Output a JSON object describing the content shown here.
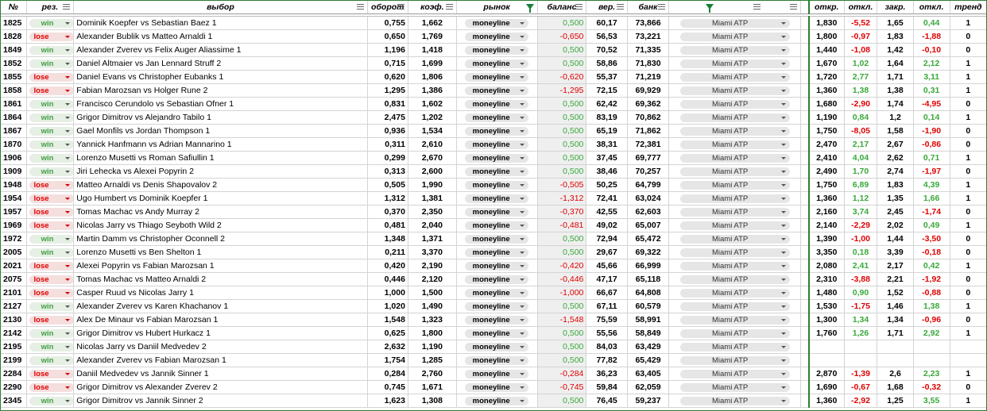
{
  "headers": {
    "num": "№",
    "res": "рез.",
    "pick": "выбор",
    "turnover": "оборот",
    "coef": "коэф.",
    "market": "рынок",
    "balance": "баланс",
    "prob": "вер.",
    "bank": "банк",
    "open": "откр.",
    "dev1": "откл.",
    "close": "закр.",
    "dev2": "откл.",
    "trend": "тренд"
  },
  "rows": [
    {
      "id": "1825",
      "res": "win",
      "pick": "Dominik Koepfer  vs  Sebastian Baez 1",
      "turnover": "0,755",
      "coef": "1,662",
      "market": "moneyline",
      "balance": "0,500",
      "prob": "60,17",
      "bank": "73,866",
      "tournament": "Miami ATP",
      "open": "1,830",
      "dev1": "-5,52",
      "close": "1,65",
      "dev2": "0,44",
      "trend": "1"
    },
    {
      "id": "1828",
      "res": "lose",
      "pick": "Alexander Bublik  vs  Matteo Arnaldi 1",
      "turnover": "0,650",
      "coef": "1,769",
      "market": "moneyline",
      "balance": "-0,650",
      "prob": "56,53",
      "bank": "73,221",
      "tournament": "Miami ATP",
      "open": "1,800",
      "dev1": "-0,97",
      "close": "1,83",
      "dev2": "-1,88",
      "trend": "0"
    },
    {
      "id": "1849",
      "res": "win",
      "pick": "Alexander Zverev  vs  Felix Auger Aliassime 1",
      "turnover": "1,196",
      "coef": "1,418",
      "market": "moneyline",
      "balance": "0,500",
      "prob": "70,52",
      "bank": "71,335",
      "tournament": "Miami ATP",
      "open": "1,440",
      "dev1": "-1,08",
      "close": "1,42",
      "dev2": "-0,10",
      "trend": "0"
    },
    {
      "id": "1852",
      "res": "win",
      "pick": "Daniel Altmaier  vs  Jan Lennard Struff 2",
      "turnover": "0,715",
      "coef": "1,699",
      "market": "moneyline",
      "balance": "0,500",
      "prob": "58,86",
      "bank": "71,830",
      "tournament": "Miami ATP",
      "open": "1,670",
      "dev1": "1,02",
      "close": "1,64",
      "dev2": "2,12",
      "trend": "1"
    },
    {
      "id": "1855",
      "res": "lose",
      "pick": "Daniel Evans  vs  Christopher Eubanks 1",
      "turnover": "0,620",
      "coef": "1,806",
      "market": "moneyline",
      "balance": "-0,620",
      "prob": "55,37",
      "bank": "71,219",
      "tournament": "Miami ATP",
      "open": "1,720",
      "dev1": "2,77",
      "close": "1,71",
      "dev2": "3,11",
      "trend": "1"
    },
    {
      "id": "1858",
      "res": "lose",
      "pick": "Fabian Marozsan  vs  Holger Rune 2",
      "turnover": "1,295",
      "coef": "1,386",
      "market": "moneyline",
      "balance": "-1,295",
      "prob": "72,15",
      "bank": "69,929",
      "tournament": "Miami ATP",
      "open": "1,360",
      "dev1": "1,38",
      "close": "1,38",
      "dev2": "0,31",
      "trend": "1"
    },
    {
      "id": "1861",
      "res": "win",
      "pick": "Francisco Cerundolo  vs  Sebastian Ofner 1",
      "turnover": "0,831",
      "coef": "1,602",
      "market": "moneyline",
      "balance": "0,500",
      "prob": "62,42",
      "bank": "69,362",
      "tournament": "Miami ATP",
      "open": "1,680",
      "dev1": "-2,90",
      "close": "1,74",
      "dev2": "-4,95",
      "trend": "0"
    },
    {
      "id": "1864",
      "res": "win",
      "pick": "Grigor Dimitrov  vs  Alejandro Tabilo 1",
      "turnover": "2,475",
      "coef": "1,202",
      "market": "moneyline",
      "balance": "0,500",
      "prob": "83,19",
      "bank": "70,862",
      "tournament": "Miami ATP",
      "open": "1,190",
      "dev1": "0,84",
      "close": "1,2",
      "dev2": "0,14",
      "trend": "1"
    },
    {
      "id": "1867",
      "res": "win",
      "pick": "Gael Monfils  vs  Jordan Thompson 1",
      "turnover": "0,936",
      "coef": "1,534",
      "market": "moneyline",
      "balance": "0,500",
      "prob": "65,19",
      "bank": "71,862",
      "tournament": "Miami ATP",
      "open": "1,750",
      "dev1": "-8,05",
      "close": "1,58",
      "dev2": "-1,90",
      "trend": "0"
    },
    {
      "id": "1870",
      "res": "win",
      "pick": "Yannick Hanfmann  vs  Adrian Mannarino 1",
      "turnover": "0,311",
      "coef": "2,610",
      "market": "moneyline",
      "balance": "0,500",
      "prob": "38,31",
      "bank": "72,381",
      "tournament": "Miami ATP",
      "open": "2,470",
      "dev1": "2,17",
      "close": "2,67",
      "dev2": "-0,86",
      "trend": "0"
    },
    {
      "id": "1906",
      "res": "win",
      "pick": "Lorenzo Musetti  vs  Roman Safiullin 1",
      "turnover": "0,299",
      "coef": "2,670",
      "market": "moneyline",
      "balance": "0,500",
      "prob": "37,45",
      "bank": "69,777",
      "tournament": "Miami ATP",
      "open": "2,410",
      "dev1": "4,04",
      "close": "2,62",
      "dev2": "0,71",
      "trend": "1"
    },
    {
      "id": "1909",
      "res": "win",
      "pick": "Jiri Lehecka  vs  Alexei Popyrin 2",
      "turnover": "0,313",
      "coef": "2,600",
      "market": "moneyline",
      "balance": "0,500",
      "prob": "38,46",
      "bank": "70,257",
      "tournament": "Miami ATP",
      "open": "2,490",
      "dev1": "1,70",
      "close": "2,74",
      "dev2": "-1,97",
      "trend": "0"
    },
    {
      "id": "1948",
      "res": "lose",
      "pick": "Matteo Arnaldi  vs  Denis Shapovalov 2",
      "turnover": "0,505",
      "coef": "1,990",
      "market": "moneyline",
      "balance": "-0,505",
      "prob": "50,25",
      "bank": "64,799",
      "tournament": "Miami ATP",
      "open": "1,750",
      "dev1": "6,89",
      "close": "1,83",
      "dev2": "4,39",
      "trend": "1"
    },
    {
      "id": "1954",
      "res": "lose",
      "pick": "Ugo Humbert  vs  Dominik Koepfer 1",
      "turnover": "1,312",
      "coef": "1,381",
      "market": "moneyline",
      "balance": "-1,312",
      "prob": "72,41",
      "bank": "63,024",
      "tournament": "Miami ATP",
      "open": "1,360",
      "dev1": "1,12",
      "close": "1,35",
      "dev2": "1,66",
      "trend": "1"
    },
    {
      "id": "1957",
      "res": "lose",
      "pick": "Tomas Machac  vs  Andy Murray 2",
      "turnover": "0,370",
      "coef": "2,350",
      "market": "moneyline",
      "balance": "-0,370",
      "prob": "42,55",
      "bank": "62,603",
      "tournament": "Miami ATP",
      "open": "2,160",
      "dev1": "3,74",
      "close": "2,45",
      "dev2": "-1,74",
      "trend": "0"
    },
    {
      "id": "1969",
      "res": "lose",
      "pick": "Nicolas Jarry  vs  Thiago Seyboth Wild 2",
      "turnover": "0,481",
      "coef": "2,040",
      "market": "moneyline",
      "balance": "-0,481",
      "prob": "49,02",
      "bank": "65,007",
      "tournament": "Miami ATP",
      "open": "2,140",
      "dev1": "-2,29",
      "close": "2,02",
      "dev2": "0,49",
      "trend": "1"
    },
    {
      "id": "1972",
      "res": "win",
      "pick": "Martin Damm  vs  Christopher Oconnell 2",
      "turnover": "1,348",
      "coef": "1,371",
      "market": "moneyline",
      "balance": "0,500",
      "prob": "72,94",
      "bank": "65,472",
      "tournament": "Miami ATP",
      "open": "1,390",
      "dev1": "-1,00",
      "close": "1,44",
      "dev2": "-3,50",
      "trend": "0"
    },
    {
      "id": "2005",
      "res": "win",
      "pick": "Lorenzo Musetti  vs  Ben Shelton 1",
      "turnover": "0,211",
      "coef": "3,370",
      "market": "moneyline",
      "balance": "0,500",
      "prob": "29,67",
      "bank": "69,322",
      "tournament": "Miami ATP",
      "open": "3,350",
      "dev1": "0,18",
      "close": "3,39",
      "dev2": "-0,18",
      "trend": "0"
    },
    {
      "id": "2021",
      "res": "lose",
      "pick": " Alexei Popyrin  vs  Fabian Marozsan 1",
      "turnover": "0,420",
      "coef": "2,190",
      "market": "moneyline",
      "balance": "-0,420",
      "prob": "45,66",
      "bank": "66,999",
      "tournament": "Miami ATP",
      "open": "2,080",
      "dev1": "2,41",
      "close": "2,17",
      "dev2": "0,42",
      "trend": "1"
    },
    {
      "id": "2075",
      "res": "lose",
      "pick": "Tomas Machac  vs  Matteo Arnaldi 2",
      "turnover": "0,446",
      "coef": "2,120",
      "market": "moneyline",
      "balance": "-0,446",
      "prob": "47,17",
      "bank": "65,118",
      "tournament": "Miami ATP",
      "open": "2,310",
      "dev1": "-3,88",
      "close": "2,21",
      "dev2": "-1,92",
      "trend": "0"
    },
    {
      "id": "2101",
      "res": "lose",
      "pick": "Casper Ruud  vs  Nicolas Jarry 1",
      "turnover": "1,000",
      "coef": "1,500",
      "market": "moneyline",
      "balance": "-1,000",
      "prob": "66,67",
      "bank": "64,808",
      "tournament": "Miami ATP",
      "open": "1,480",
      "dev1": "0,90",
      "close": "1,52",
      "dev2": "-0,88",
      "trend": "0"
    },
    {
      "id": "2127",
      "res": "win",
      "pick": "Alexander Zverev  vs  Karen Khachanov 1",
      "turnover": "1,020",
      "coef": "1,490",
      "market": "moneyline",
      "balance": "0,500",
      "prob": "67,11",
      "bank": "60,579",
      "tournament": "Miami ATP",
      "open": "1,530",
      "dev1": "-1,75",
      "close": "1,46",
      "dev2": "1,38",
      "trend": "1"
    },
    {
      "id": "2130",
      "res": "lose",
      "pick": "Alex De Minaur  vs  Fabian Marozsan 1",
      "turnover": "1,548",
      "coef": "1,323",
      "market": "moneyline",
      "balance": "-1,548",
      "prob": "75,59",
      "bank": "58,991",
      "tournament": "Miami ATP",
      "open": "1,300",
      "dev1": "1,34",
      "close": "1,34",
      "dev2": "-0,96",
      "trend": "0"
    },
    {
      "id": "2142",
      "res": "win",
      "pick": "Grigor Dimitrov  vs  Hubert Hurkacz 1",
      "turnover": "0,625",
      "coef": "1,800",
      "market": "moneyline",
      "balance": "0,500",
      "prob": "55,56",
      "bank": "58,849",
      "tournament": "Miami ATP",
      "open": "1,760",
      "dev1": "1,26",
      "close": "1,71",
      "dev2": "2,92",
      "trend": "1"
    },
    {
      "id": "2195",
      "res": "win",
      "pick": "Nicolas Jarry  vs  Daniil Medvedev 2",
      "turnover": "2,632",
      "coef": "1,190",
      "market": "moneyline",
      "balance": "0,500",
      "prob": "84,03",
      "bank": "63,429",
      "tournament": "Miami ATP",
      "open": "",
      "dev1": "",
      "close": "",
      "dev2": "",
      "trend": ""
    },
    {
      "id": "2199",
      "res": "win",
      "pick": "Alexander Zverev  vs  Fabian Marozsan 1",
      "turnover": "1,754",
      "coef": "1,285",
      "market": "moneyline",
      "balance": "0,500",
      "prob": "77,82",
      "bank": "65,429",
      "tournament": "Miami ATP",
      "open": "",
      "dev1": "",
      "close": "",
      "dev2": "",
      "trend": ""
    },
    {
      "id": "2284",
      "res": "lose",
      "pick": "Daniil Medvedev  vs  Jannik Sinner 1",
      "turnover": "0,284",
      "coef": "2,760",
      "market": "moneyline",
      "balance": "-0,284",
      "prob": "36,23",
      "bank": "63,405",
      "tournament": "Miami ATP",
      "open": "2,870",
      "dev1": "-1,39",
      "close": "2,6",
      "dev2": "2,23",
      "trend": "1"
    },
    {
      "id": "2290",
      "res": "lose",
      "pick": "Grigor Dimitrov  vs  Alexander Zverev 2",
      "turnover": "0,745",
      "coef": "1,671",
      "market": "moneyline",
      "balance": "-0,745",
      "prob": "59,84",
      "bank": "62,059",
      "tournament": "Miami ATP",
      "open": "1,690",
      "dev1": "-0,67",
      "close": "1,68",
      "dev2": "-0,32",
      "trend": "0"
    },
    {
      "id": "2345",
      "res": "win",
      "pick": "Grigor Dimitrov  vs  Jannik Sinner 2",
      "turnover": "1,623",
      "coef": "1,308",
      "market": "moneyline",
      "balance": "0,500",
      "prob": "76,45",
      "bank": "59,237",
      "tournament": "Miami ATP",
      "open": "1,360",
      "dev1": "-2,92",
      "close": "1,25",
      "dev2": "3,55",
      "trend": "1"
    }
  ],
  "colors": {
    "win": "#38a93a",
    "lose": "#e00000",
    "border": "#2e7d32",
    "balance_bg": "#efefef"
  }
}
